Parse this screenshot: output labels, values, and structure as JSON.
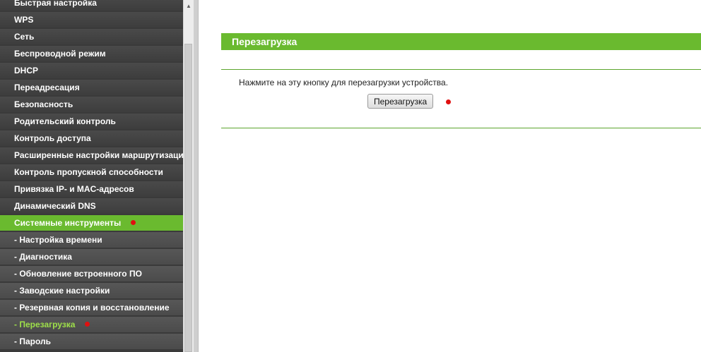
{
  "sidebar": {
    "items": [
      {
        "label": "Быстрая настройка",
        "level": "top"
      },
      {
        "label": "WPS",
        "level": "top"
      },
      {
        "label": "Сеть",
        "level": "top"
      },
      {
        "label": "Беспроводной режим",
        "level": "top"
      },
      {
        "label": "DHCP",
        "level": "top"
      },
      {
        "label": "Переадресация",
        "level": "top"
      },
      {
        "label": "Безопасность",
        "level": "top"
      },
      {
        "label": "Родительский контроль",
        "level": "top"
      },
      {
        "label": "Контроль доступа",
        "level": "top"
      },
      {
        "label": "Расширенные настройки маршрутизации",
        "level": "top"
      },
      {
        "label": "Контроль пропускной способности",
        "level": "top"
      },
      {
        "label": "Привязка IP- и MAC-адресов",
        "level": "top"
      },
      {
        "label": "Динамический DNS",
        "level": "top"
      },
      {
        "label": "Системные инструменты",
        "level": "top",
        "active": true
      },
      {
        "label": "- Настройка времени",
        "level": "sub"
      },
      {
        "label": "- Диагностика",
        "level": "sub"
      },
      {
        "label": "- Обновление встроенного ПО",
        "level": "sub"
      },
      {
        "label": "- Заводские настройки",
        "level": "sub"
      },
      {
        "label": "- Резервная копия и восстановление",
        "level": "sub"
      },
      {
        "label": "- Перезагрузка",
        "level": "sub",
        "selected": true
      },
      {
        "label": "- Пароль",
        "level": "sub"
      }
    ]
  },
  "main": {
    "section_title": "Перезагрузка",
    "description": "Нажмите на эту кнопку для перезагрузки устройства.",
    "reboot_button_label": "Перезагрузка"
  },
  "colors": {
    "accent_green": "#6aba2f",
    "selected_sub_text": "#9ee04a",
    "marker_red": "#e01010",
    "sidebar_dark": "#3a3a3a"
  }
}
